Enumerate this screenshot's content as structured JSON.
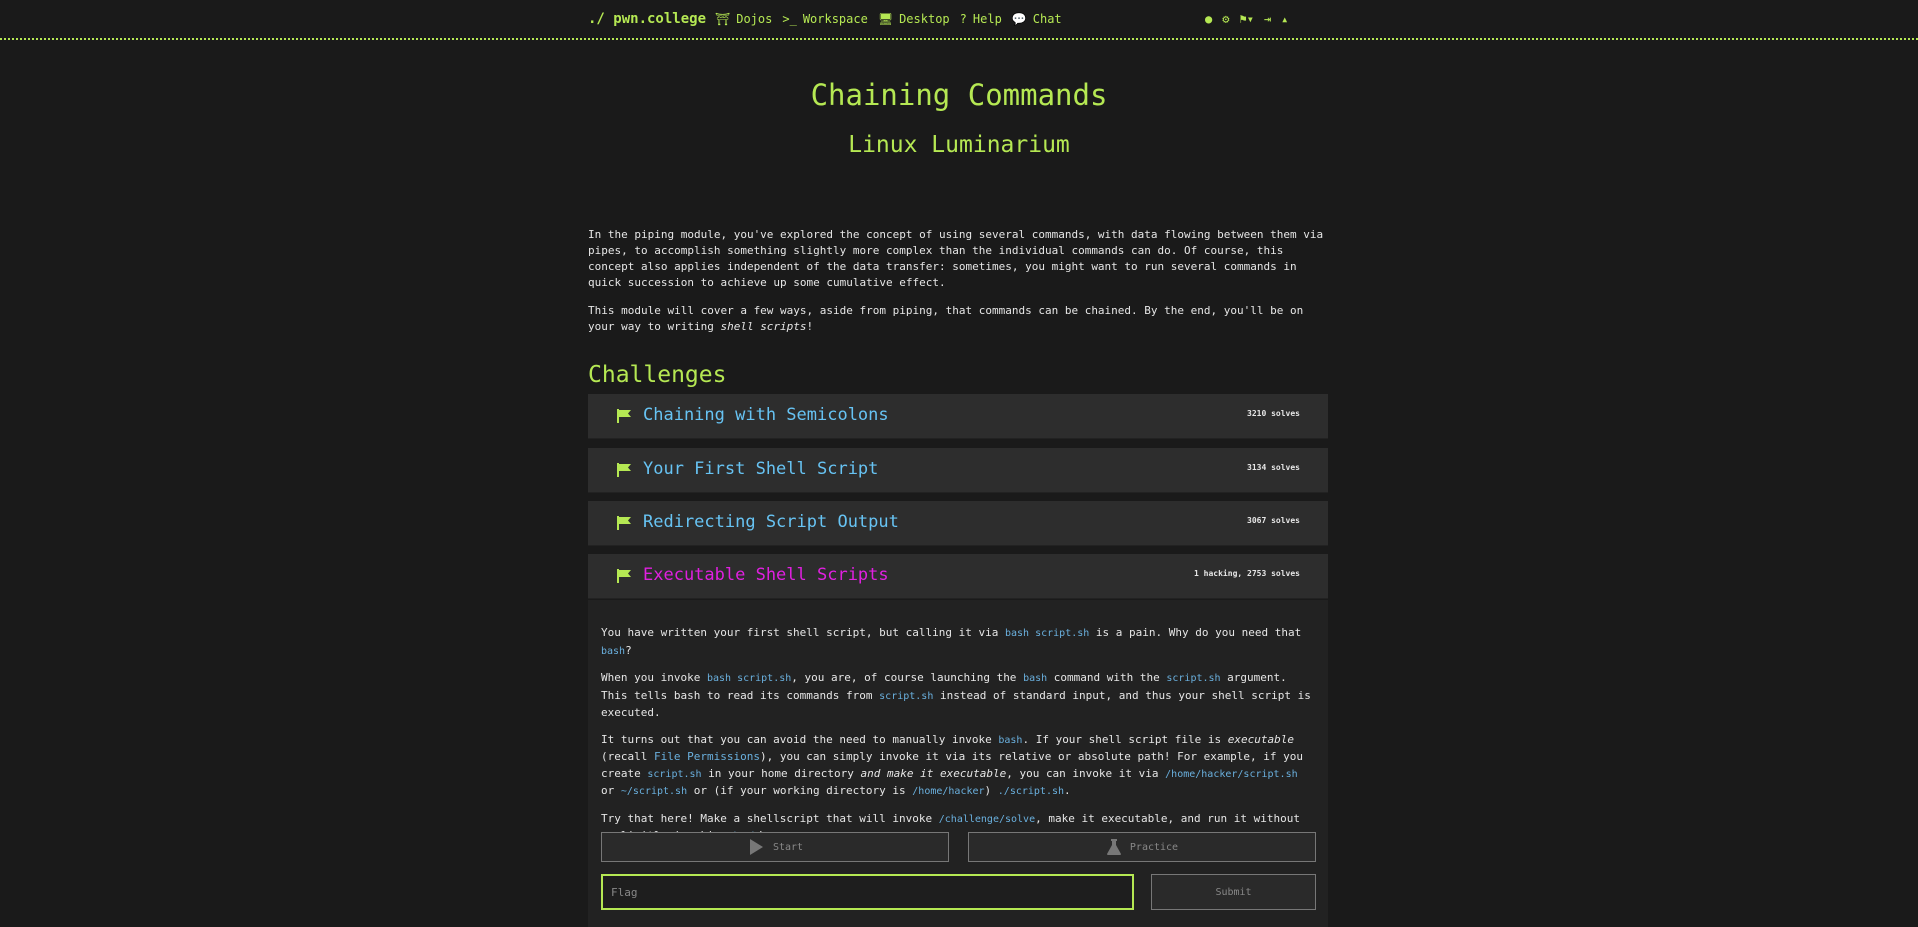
{
  "nav": {
    "brand": "./ pwn.college",
    "items": [
      {
        "label": "Dojos",
        "icon": "dojo-icon"
      },
      {
        "label": "Workspace",
        "icon": "terminal-icon"
      },
      {
        "label": "Desktop",
        "icon": "desktop-icon"
      },
      {
        "label": "Help",
        "icon": "question-icon"
      },
      {
        "label": "Chat",
        "icon": "chat-icon"
      }
    ],
    "right_icons": [
      "user-icon",
      "settings-icon",
      "flag-dropdown-icon",
      "logout-icon",
      "caret-up-icon"
    ]
  },
  "header": {
    "title": "Chaining Commands",
    "subtitle": "Linux Luminarium"
  },
  "intro": {
    "p1": "In the piping module, you've explored the concept of using several commands, with data flowing between them via pipes, to accomplish something slightly more complex than the individual commands can do. Of course, this concept also applies independent of the data transfer: sometimes, you might want to run several commands in quick succession to achieve up some cumulative effect.",
    "p2_a": "This module will cover a few ways, aside from piping, that commands can be chained. By the end, you'll be on your way to writing ",
    "p2_em": "shell scripts",
    "p2_b": "!"
  },
  "challenges_heading": "Challenges",
  "challenges": [
    {
      "name": "Chaining with Semicolons",
      "solves": "3210 solves"
    },
    {
      "name": "Your First Shell Script",
      "solves": "3134 solves"
    },
    {
      "name": "Redirecting Script Output",
      "solves": "3067 solves"
    },
    {
      "name": "Executable Shell Scripts",
      "solves": "1 hacking, 2753 solves"
    }
  ],
  "active": {
    "p1_a": "You have written your first shell script, but calling it via ",
    "p1_code1": "bash script.sh",
    "p1_b": " is a pain. Why do you need that ",
    "p1_code2": "bash",
    "p1_c": "?",
    "p2_a": "When you invoke ",
    "p2_code1": "bash script.sh",
    "p2_b": ", you are, of course launching the ",
    "p2_code2": "bash",
    "p2_c": " command with the ",
    "p2_code3": "script.sh",
    "p2_d": " argument. This tells bash to read its commands from ",
    "p2_code4": "script.sh",
    "p2_e": " instead of standard input, and thus your shell script is executed.",
    "p3_a": "It turns out that you can avoid the need to manually invoke ",
    "p3_code1": "bash",
    "p3_b": ". If your shell script file is ",
    "p3_em1": "executable",
    "p3_c": " (recall ",
    "p3_link": "File Permissions",
    "p3_d": "), you can simply invoke it via its relative or absolute path! For example, if you create ",
    "p3_code2": "script.sh",
    "p3_e": " in your home directory ",
    "p3_em2": "and make it executable",
    "p3_f": ", you can invoke it via ",
    "p3_code3": "/home/hacker/script.sh",
    "p3_g": " or ",
    "p3_code4": "~/script.sh",
    "p3_h": " or (if your working directory is ",
    "p3_code5": "/home/hacker",
    "p3_i": ") ",
    "p3_code6": "./script.sh",
    "p3_j": ".",
    "p4_a": "Try that here! Make a shellscript that will invoke ",
    "p4_code1": "/challenge/solve",
    "p4_b": ", make it executable, and run it without explicitly invoking ",
    "p4_code2": "bash",
    "p4_c": "!",
    "start_label": "Start",
    "practice_label": "Practice",
    "flag_placeholder": "Flag",
    "submit_label": "Submit"
  },
  "colors": {
    "accent": "#b5e853",
    "link": "#67c3f3",
    "active_challenge": "#e020e0"
  }
}
